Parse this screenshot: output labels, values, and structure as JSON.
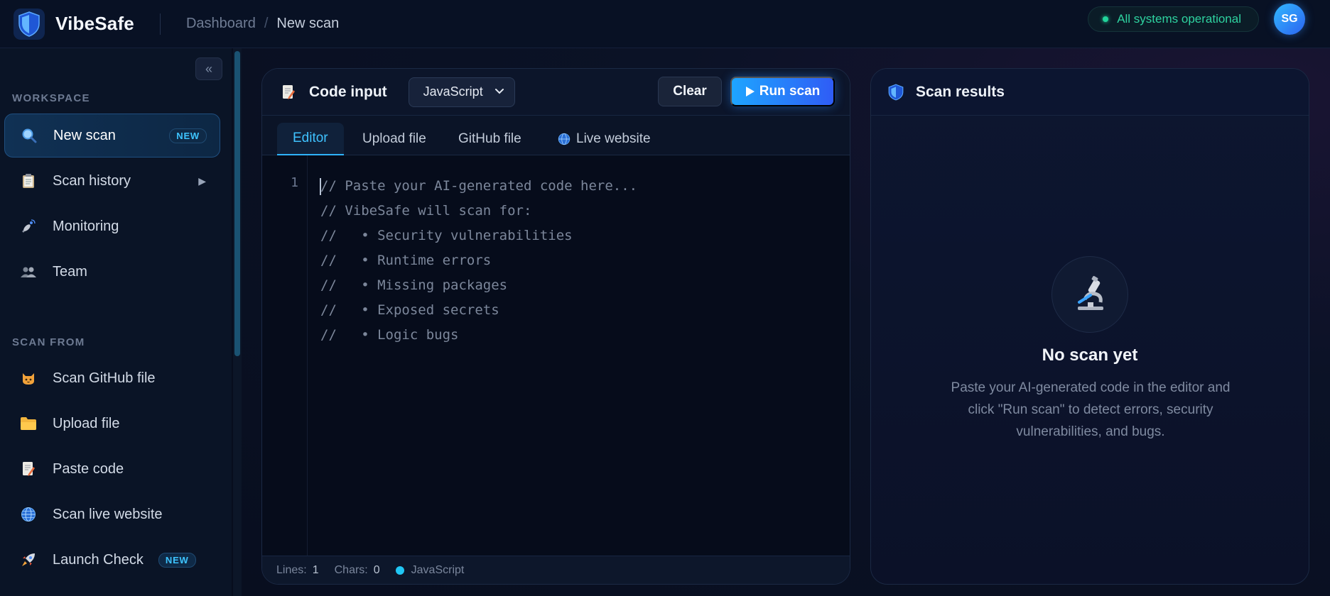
{
  "app": {
    "name": "VibeSafe",
    "breadcrumb": {
      "root": "Dashboard",
      "separator": "/",
      "current": "New scan"
    },
    "status": "All systems operational",
    "user_initials": "SG",
    "collapse_glyph": "«"
  },
  "sidebar": {
    "workspace_label": "WORKSPACE",
    "workspace_items": [
      {
        "label": "New scan",
        "icon": "magnifier-icon",
        "badge": "NEW",
        "active": true
      },
      {
        "label": "Scan history",
        "icon": "clipboard-icon",
        "arrow": "▶"
      },
      {
        "label": "Monitoring",
        "icon": "satellite-icon"
      },
      {
        "label": "Team",
        "icon": "people-icon"
      }
    ],
    "scan_from_label": "SCAN FROM",
    "scan_from_items": [
      {
        "label": "Scan GitHub file",
        "icon": "cat-icon"
      },
      {
        "label": "Upload file",
        "icon": "folder-icon"
      },
      {
        "label": "Paste code",
        "icon": "memo-icon"
      },
      {
        "label": "Scan live website",
        "icon": "globe-icon"
      },
      {
        "label": "Launch Check",
        "icon": "rocket-icon",
        "badge": "NEW"
      }
    ]
  },
  "code_input": {
    "title": "Code input",
    "language": "JavaScript",
    "clear_label": "Clear",
    "run_label": "Run scan",
    "tabs": [
      "Editor",
      "Upload file",
      "GitHub file",
      "Live website"
    ],
    "active_tab": "Editor",
    "line_number": "1",
    "placeholder_lines": [
      "// Paste your AI-generated code here...",
      "// VibeSafe will scan for:",
      "//   • Security vulnerabilities",
      "//   • Runtime errors",
      "//   • Missing packages",
      "//   • Exposed secrets",
      "//   • Logic bugs"
    ],
    "status": {
      "lines_label": "Lines:",
      "lines_value": "1",
      "chars_label": "Chars:",
      "chars_value": "0",
      "language": "JavaScript"
    }
  },
  "results": {
    "title": "Scan results",
    "empty_title": "No scan yet",
    "empty_text": "Paste your AI-generated code in the editor and click \"Run scan\" to detect errors, security vulnerabilities, and bugs."
  },
  "colors": {
    "accent": "#2fb3ff",
    "status_green": "#22d39b",
    "background": "#070d1d"
  }
}
